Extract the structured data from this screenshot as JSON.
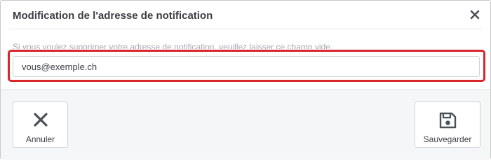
{
  "dialog": {
    "title": "Modification de l'adresse de notification",
    "close_icon": "close-icon",
    "hint": "Si vous voulez supprimer votre adresse de notification, veuillez laisser ce champ vide.",
    "email_value": "vous@exemple.ch",
    "highlight_color": "#d7262c"
  },
  "footer": {
    "cancel_label": "Annuler",
    "cancel_icon": "x-icon",
    "save_label": "Sauvegarder",
    "save_icon": "floppy-disk-icon"
  }
}
